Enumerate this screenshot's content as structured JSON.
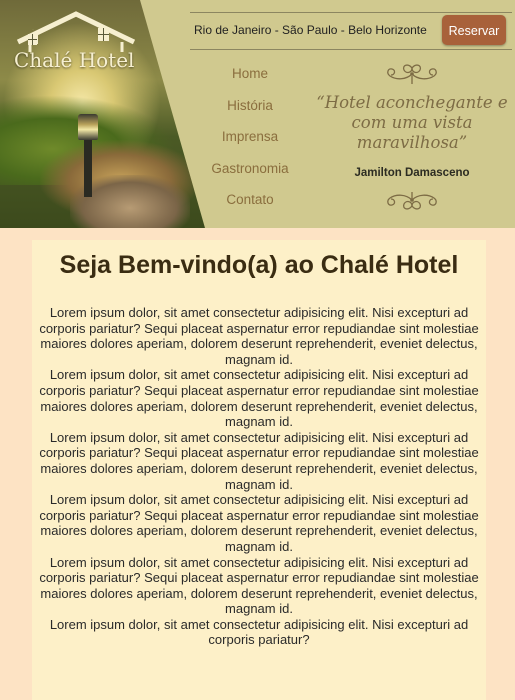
{
  "brand": {
    "name": "Chalé Hotel"
  },
  "header": {
    "cities": "Rio de Janeiro - São Paulo - Belo Horizonte",
    "reserve_label": "Reservar"
  },
  "nav": {
    "items": [
      "Home",
      "História",
      "Imprensa",
      "Gastronomia",
      "Contato"
    ]
  },
  "testimonial": {
    "quote": "“Hotel aconchegante e com uma vista maravilhosa”",
    "author": "Jamilton Damasceno"
  },
  "main": {
    "title": "Seja Bem-vindo(a) ao Chalé Hotel",
    "paragraphs": [
      "Lorem ipsum dolor, sit amet consectetur adipisicing elit. Nisi excepturi ad corporis pariatur? Sequi placeat aspernatur error repudiandae sint molestiae maiores dolores aperiam, dolorem deserunt reprehenderit, eveniet delectus, magnam id.",
      "Lorem ipsum dolor, sit amet consectetur adipisicing elit. Nisi excepturi ad corporis pariatur? Sequi placeat aspernatur error repudiandae sint molestiae maiores dolores aperiam, dolorem deserunt reprehenderit, eveniet delectus, magnam id.",
      "Lorem ipsum dolor, sit amet consectetur adipisicing elit. Nisi excepturi ad corporis pariatur? Sequi placeat aspernatur error repudiandae sint molestiae maiores dolores aperiam, dolorem deserunt reprehenderit, eveniet delectus, magnam id.",
      "Lorem ipsum dolor, sit amet consectetur adipisicing elit. Nisi excepturi ad corporis pariatur? Sequi placeat aspernatur error repudiandae sint molestiae maiores dolores aperiam, dolorem deserunt reprehenderit, eveniet delectus, magnam id.",
      "Lorem ipsum dolor, sit amet consectetur adipisicing elit. Nisi excepturi ad corporis pariatur? Sequi placeat aspernatur error repudiandae sint molestiae maiores dolores aperiam, dolorem deserunt reprehenderit, eveniet delectus, magnam id.",
      "Lorem ipsum dolor, sit amet consectetur adipisicing elit. Nisi excepturi ad corporis pariatur?"
    ]
  },
  "colors": {
    "page_bg": "#fde3c4",
    "header_bg": "#d0c98f",
    "content_bg": "#fdf0c8",
    "accent_button": "#a8613a",
    "nav_text": "#8a6e3e",
    "quote_text": "#7d6c45"
  },
  "icons": [
    "chalet-roof-logo-icon",
    "ornament-flourish-icon"
  ]
}
